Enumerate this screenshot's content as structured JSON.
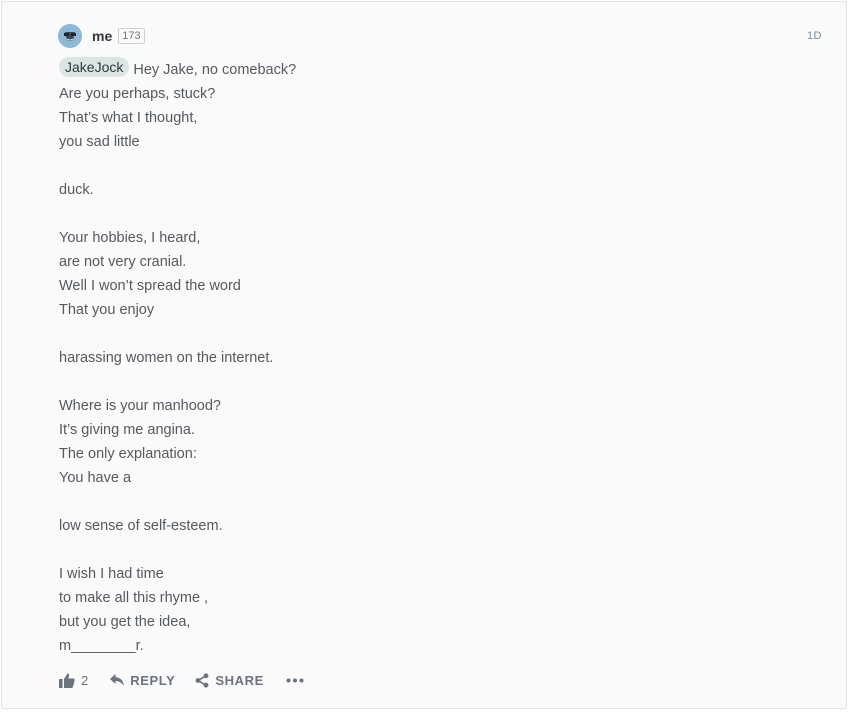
{
  "comment": {
    "author": "me",
    "reputation": "173",
    "timestamp": "1D",
    "mention": "JakeJock",
    "lines": [
      "Hey Jake, no comeback?",
      "Are you perhaps, stuck?",
      "That’s what I thought,",
      "you sad little",
      "",
      "duck.",
      "",
      "Your hobbies, I heard,",
      "are not very cranial.",
      "Well I won’t spread the word",
      "That you enjoy",
      "",
      "harassing women on the internet.",
      "",
      "Where is your manhood?",
      "It’s giving me angina.",
      "The only explanation:",
      "You have a",
      "",
      "low sense of self-esteem.",
      "",
      "I wish I had time",
      "to make all this rhyme ,",
      "but you get the idea,",
      "m________r."
    ]
  },
  "actions": {
    "like_count": "2",
    "reply_label": "REPLY",
    "share_label": "SHARE"
  },
  "icons": {
    "like": "thumbs-up-icon",
    "reply": "reply-arrow-icon",
    "share": "share-icon",
    "more": "ellipsis-icon"
  },
  "colors": {
    "mention_bg": "#dde4e4",
    "text": "#555a5f",
    "action": "#6b737d"
  }
}
